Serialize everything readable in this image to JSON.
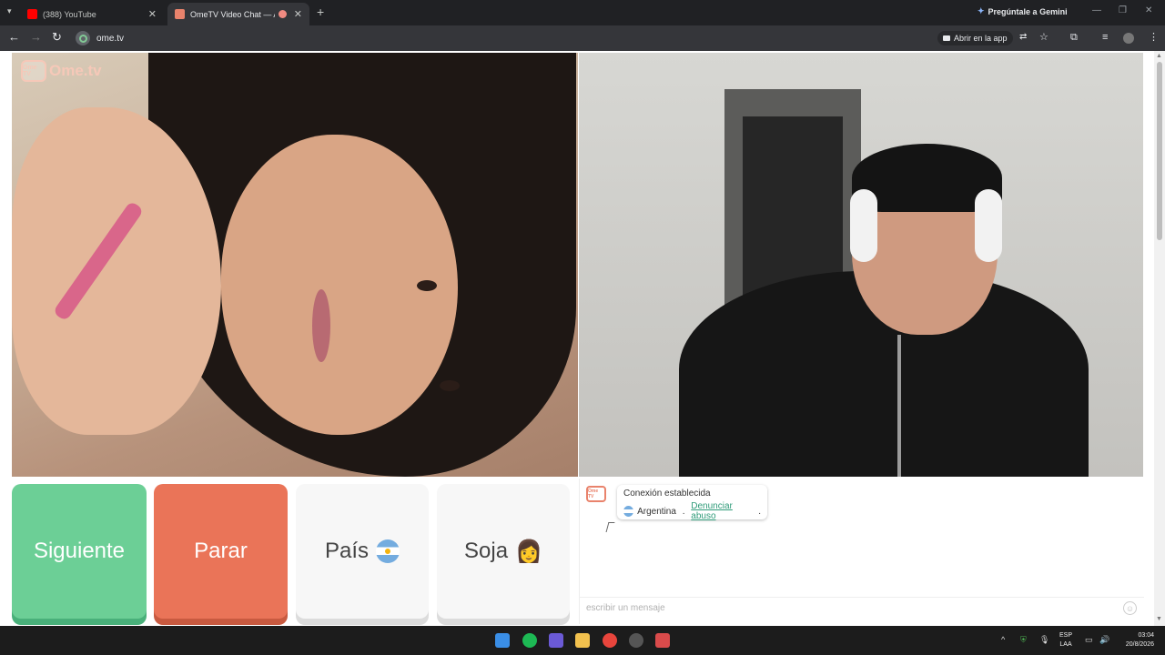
{
  "browser": {
    "tabs_menu_icon": "chevron-down",
    "tabs": [
      {
        "title": "(388) YouTube",
        "favicon_color": "#ff0000",
        "close": "✕"
      },
      {
        "title": "OmeTV Video Chat — Alter",
        "favicon_color": "#e9836c",
        "close": "✕"
      }
    ],
    "new_tab": "+",
    "gemini_label": "Pregúntale a Gemini",
    "url": "ome.tv",
    "open_in_app": "Abrir en la app"
  },
  "video": {
    "logo_tv": "Ome TV",
    "logo_brand": "Ome.tv"
  },
  "controls": {
    "next_label": "Siguiente",
    "stop_label": "Parar",
    "country_label": "País",
    "gender_label": "Soja",
    "gender_emoji": "👩"
  },
  "chat": {
    "logo_text": "Ome TV",
    "connection_message": "Conexión establecida",
    "country": "Argentina",
    "separator": " . ",
    "report_link": "Denunciar abuso",
    "report_suffix": ".",
    "input_placeholder": "escribir un mensaje"
  },
  "taskbar": {
    "language_line1": "ESP",
    "language_line2": "LAA",
    "time": "03:04",
    "date": "20/8/2026"
  },
  "colors": {
    "next_button": "#6ccf96",
    "stop_button": "#ea7458",
    "report_link": "#2f9b79"
  }
}
